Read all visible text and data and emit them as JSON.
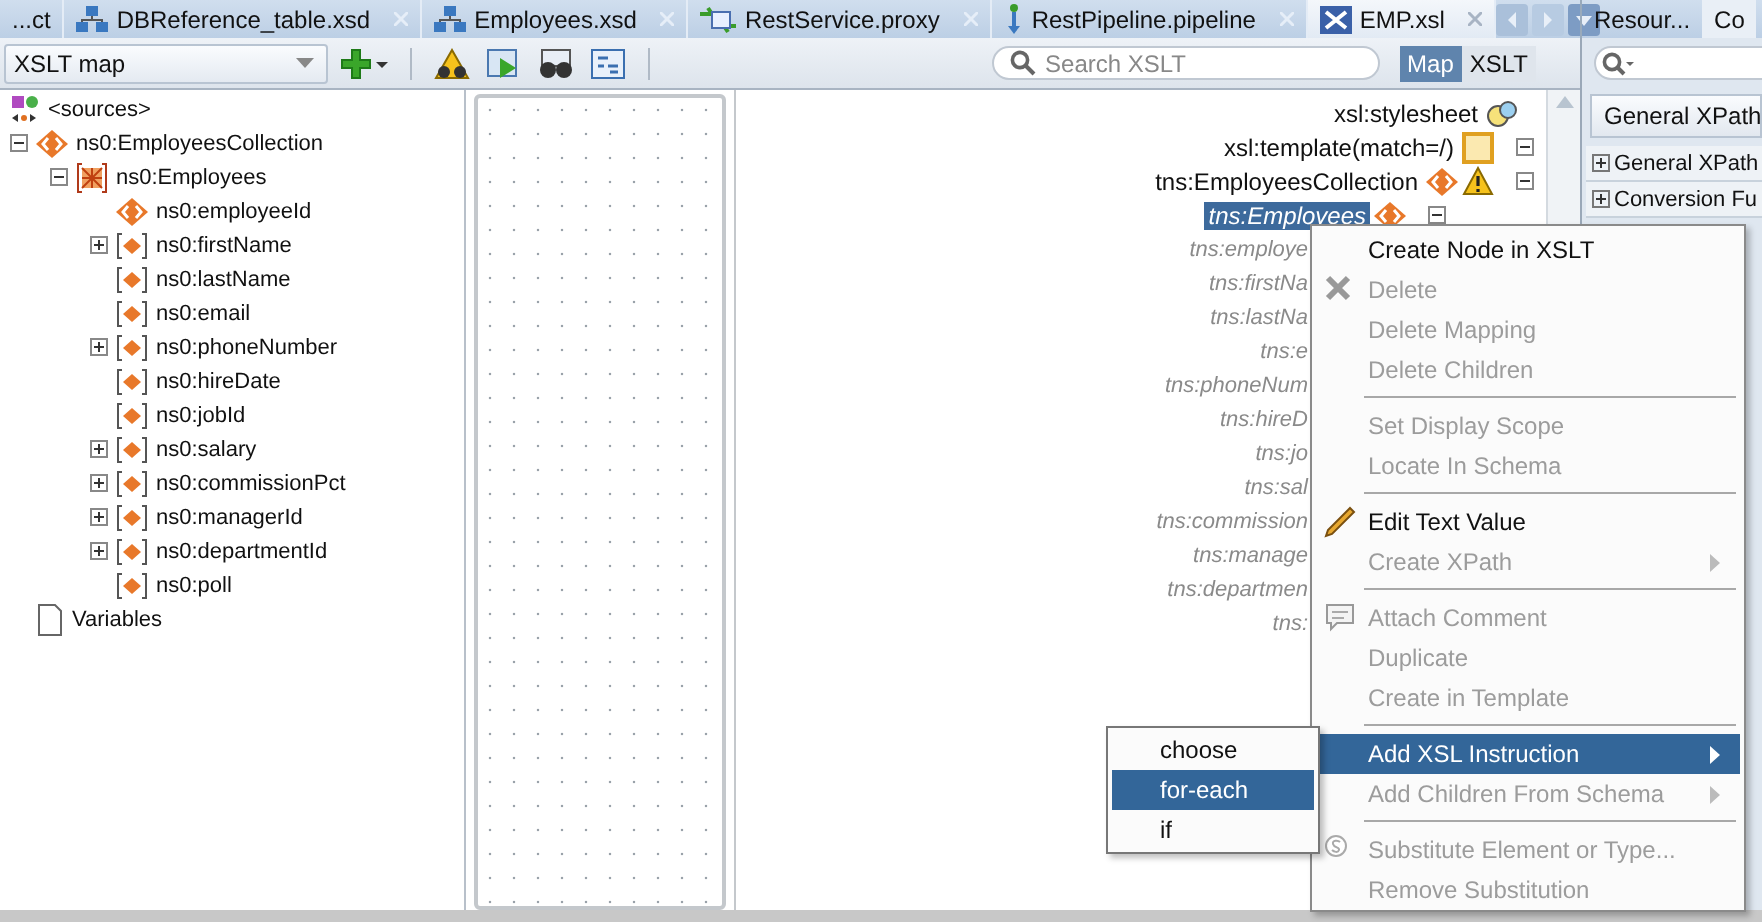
{
  "editor_tabs": [
    {
      "label": "...ct",
      "kind": "plain",
      "selected": false
    },
    {
      "label": "DBReference_table.xsd",
      "kind": "schema",
      "selected": false
    },
    {
      "label": "Employees.xsd",
      "kind": "schema",
      "selected": false
    },
    {
      "label": "RestService.proxy",
      "kind": "proxy",
      "selected": false
    },
    {
      "label": "RestPipeline.pipeline",
      "kind": "pipeline",
      "selected": false
    },
    {
      "label": "EMP.xsl",
      "kind": "xsl",
      "selected": true
    }
  ],
  "side_tabs": [
    {
      "label": "Resour...",
      "selected": false
    },
    {
      "label": "Co",
      "selected": true
    }
  ],
  "toolbar": {
    "view_select": "XSLT map",
    "search": {
      "placeholder": "Search XSLT"
    },
    "modes": [
      {
        "label": "Map",
        "selected": true
      },
      {
        "label": "XSLT",
        "selected": false
      }
    ]
  },
  "source_tree": {
    "root": "<sources>",
    "items": [
      {
        "label": "ns0:EmployeesCollection",
        "kind": "element",
        "expanded": true,
        "children": [
          {
            "label": "ns0:Employees",
            "kind": "collection",
            "expanded": true,
            "children": [
              {
                "label": "ns0:employeeId",
                "kind": "element"
              },
              {
                "label": "ns0:firstName",
                "kind": "optional",
                "expanded": false
              },
              {
                "label": "ns0:lastName",
                "kind": "optional"
              },
              {
                "label": "ns0:email",
                "kind": "optional"
              },
              {
                "label": "ns0:phoneNumber",
                "kind": "optional",
                "expanded": false
              },
              {
                "label": "ns0:hireDate",
                "kind": "optional"
              },
              {
                "label": "ns0:jobId",
                "kind": "optional"
              },
              {
                "label": "ns0:salary",
                "kind": "optional",
                "expanded": false
              },
              {
                "label": "ns0:commissionPct",
                "kind": "optional",
                "expanded": false
              },
              {
                "label": "ns0:managerId",
                "kind": "optional",
                "expanded": false
              },
              {
                "label": "ns0:departmentId",
                "kind": "optional",
                "expanded": false
              },
              {
                "label": "ns0:poll",
                "kind": "optional"
              }
            ]
          }
        ]
      },
      {
        "label": "Variables",
        "kind": "variables"
      }
    ]
  },
  "target_tree": {
    "items": [
      {
        "label": "xsl:stylesheet",
        "kind": "stylesheet",
        "selected": false,
        "children": [
          {
            "label": "xsl:template(match=/)",
            "kind": "template",
            "expanded": true,
            "selected": false,
            "children": [
              {
                "label": "tns:EmployeesCollection",
                "kind": "element",
                "warning": true,
                "expanded": true,
                "selected": false,
                "children": [
                  {
                    "label": "tns:Employees",
                    "kind": "element",
                    "warning": false,
                    "expanded": true,
                    "selected": true,
                    "children": [
                      {
                        "label": "tns:employe",
                        "kind": "field",
                        "selected": false
                      },
                      {
                        "label": "tns:firstNa",
                        "kind": "field",
                        "selected": false
                      },
                      {
                        "label": "tns:lastNa",
                        "kind": "field",
                        "selected": false
                      },
                      {
                        "label": "tns:e",
                        "kind": "field",
                        "selected": false
                      },
                      {
                        "label": "tns:phoneNum",
                        "kind": "field",
                        "selected": false
                      },
                      {
                        "label": "tns:hireD",
                        "kind": "field",
                        "selected": false
                      },
                      {
                        "label": "tns:jo",
                        "kind": "field",
                        "selected": false
                      },
                      {
                        "label": "tns:sal",
                        "kind": "field",
                        "selected": false
                      },
                      {
                        "label": "tns:commission",
                        "kind": "field",
                        "selected": false
                      },
                      {
                        "label": "tns:manage",
                        "kind": "field",
                        "selected": false
                      },
                      {
                        "label": "tns:departmen",
                        "kind": "field",
                        "selected": false
                      },
                      {
                        "label": "tns:",
                        "kind": "field",
                        "selected": false
                      }
                    ]
                  }
                ]
              }
            ]
          }
        ]
      }
    ]
  },
  "side_panel": {
    "category_select": "General XPath",
    "sections": [
      {
        "label": "General XPath",
        "expanded": false
      },
      {
        "label": "Conversion Fu",
        "expanded": false
      }
    ]
  },
  "context_menu": {
    "items": [
      {
        "kind": "item",
        "label": "Create Node in XSLT",
        "disabled": false,
        "selected": false,
        "submenu": false
      },
      {
        "kind": "item",
        "label": "Delete",
        "disabled": true,
        "selected": false,
        "submenu": false
      },
      {
        "kind": "item",
        "label": "Delete Mapping",
        "disabled": true,
        "selected": false,
        "submenu": false
      },
      {
        "kind": "item",
        "label": "Delete Children",
        "disabled": true,
        "selected": false,
        "submenu": false
      },
      {
        "kind": "separator"
      },
      {
        "kind": "item",
        "label": "Set Display Scope",
        "disabled": true,
        "selected": false,
        "submenu": false
      },
      {
        "kind": "item",
        "label": "Locate In Schema",
        "disabled": true,
        "selected": false,
        "submenu": false
      },
      {
        "kind": "separator"
      },
      {
        "kind": "item",
        "label": "Edit Text Value",
        "disabled": false,
        "selected": false,
        "submenu": false
      },
      {
        "kind": "item",
        "label": "Create XPath",
        "disabled": true,
        "selected": false,
        "submenu": true
      },
      {
        "kind": "separator"
      },
      {
        "kind": "item",
        "label": "Attach Comment",
        "disabled": true,
        "selected": false,
        "submenu": false
      },
      {
        "kind": "item",
        "label": "Duplicate",
        "disabled": true,
        "selected": false,
        "submenu": false
      },
      {
        "kind": "item",
        "label": "Create in Template",
        "disabled": true,
        "selected": false,
        "submenu": false
      },
      {
        "kind": "separator"
      },
      {
        "kind": "item",
        "label": "Add XSL Instruction",
        "disabled": false,
        "selected": true,
        "submenu": true
      },
      {
        "kind": "item",
        "label": "Add Children From Schema",
        "disabled": true,
        "selected": false,
        "submenu": true
      },
      {
        "kind": "separator"
      },
      {
        "kind": "item",
        "label": "Substitute Element or Type...",
        "disabled": true,
        "selected": false,
        "submenu": false
      },
      {
        "kind": "item",
        "label": "Remove Substitution",
        "disabled": true,
        "selected": false,
        "submenu": false
      }
    ]
  },
  "submenu": {
    "items": [
      {
        "label": "choose",
        "selected": false
      },
      {
        "label": "for-each",
        "selected": true
      },
      {
        "label": "if",
        "selected": false
      }
    ]
  }
}
